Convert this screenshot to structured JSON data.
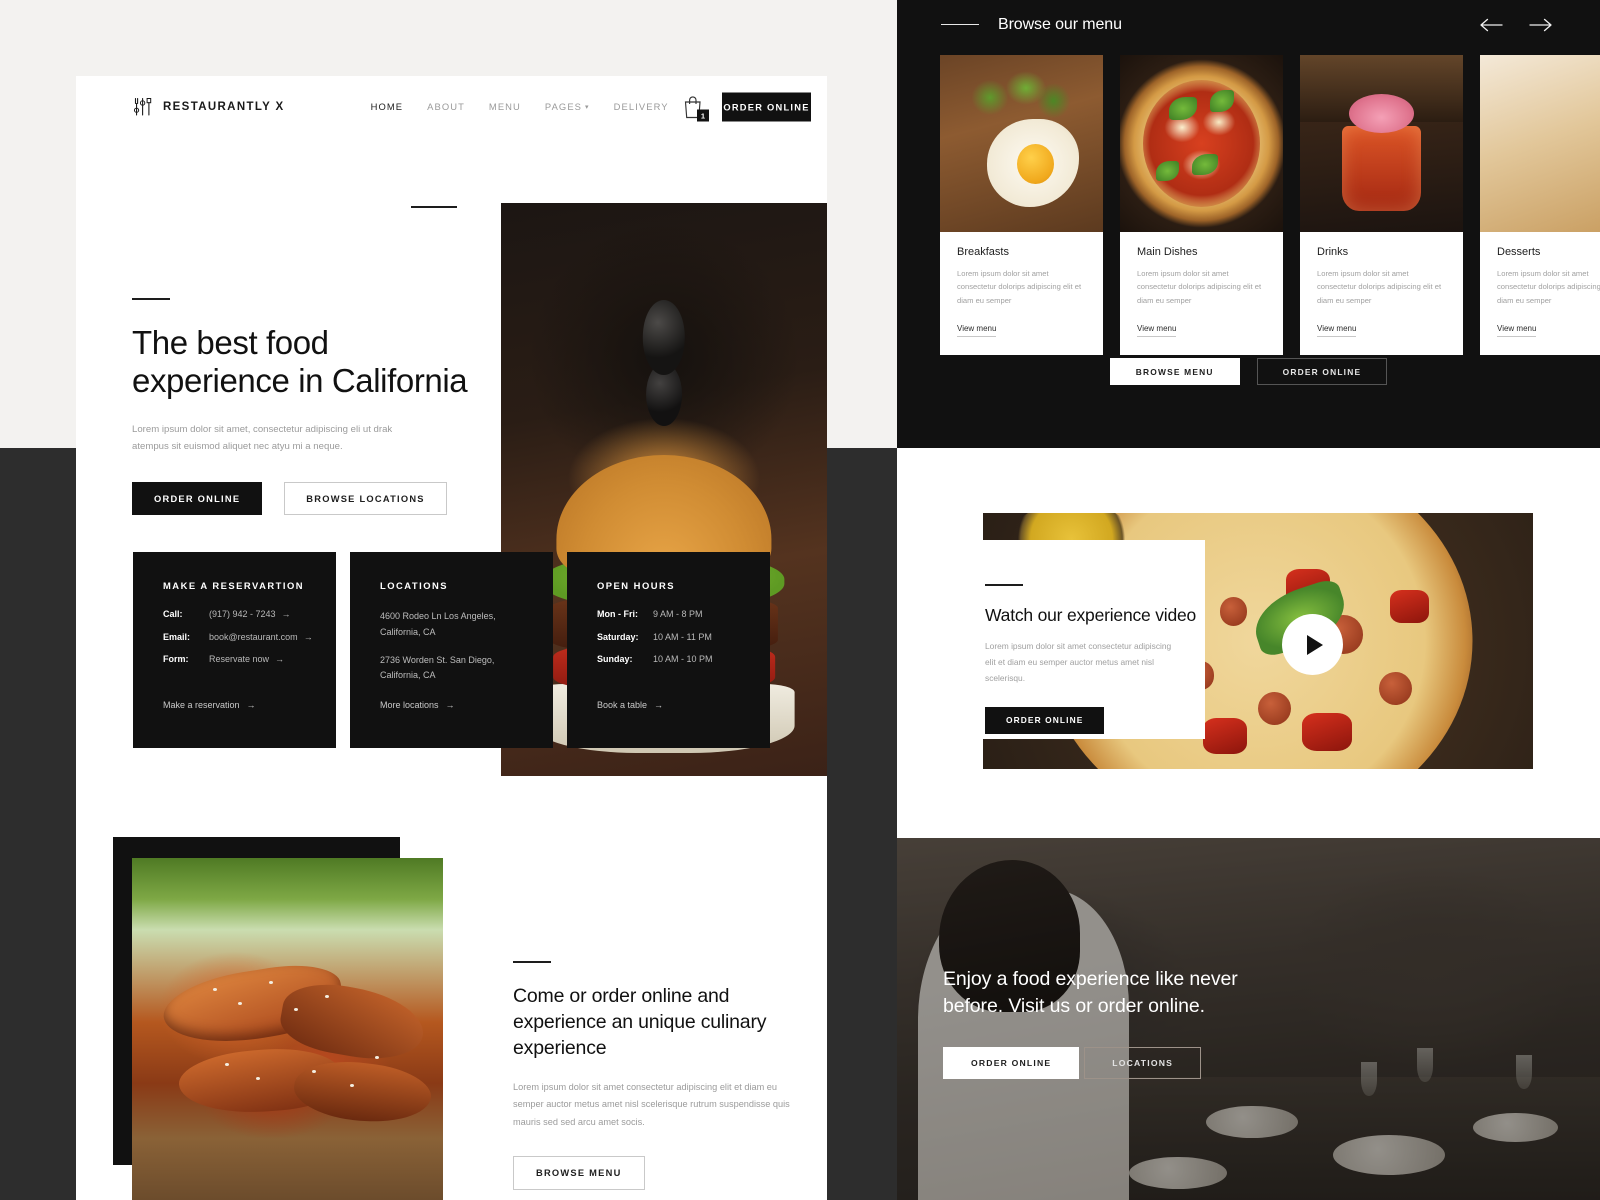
{
  "site": {
    "brand_name": "RESTAURANTLY X",
    "brand_icon": "cutlery-icon"
  },
  "header": {
    "nav": [
      {
        "label": "HOME",
        "active": true,
        "has_caret": false
      },
      {
        "label": "ABOUT",
        "active": false,
        "has_caret": false
      },
      {
        "label": "MENU",
        "active": false,
        "has_caret": false
      },
      {
        "label": "PAGES",
        "active": false,
        "has_caret": true
      },
      {
        "label": "DELIVERY",
        "active": false,
        "has_caret": false
      }
    ],
    "cart_icon": "shopping-bag-icon",
    "cart_count": "1",
    "order_button": "ORDER ONLINE"
  },
  "hero": {
    "title_line1": "The best food",
    "title_line2": "experience in California",
    "subtitle": "Lorem ipsum dolor sit amet, consectetur adipiscing eli ut drak atempus sit euismod aliquet nec atyu mi a neque.",
    "primary_button": "ORDER ONLINE",
    "secondary_button": "BROWSE LOCATIONS",
    "image_alt": "burger-photo"
  },
  "info_cards": [
    {
      "title": "MAKE A RESERVARTION",
      "rows": [
        {
          "key": "Call:",
          "value": "(917) 942 - 7243"
        },
        {
          "key": "Email:",
          "value": "book@restaurant.com"
        },
        {
          "key": "Form:",
          "value": "Reservate now"
        }
      ],
      "link": "Make a reservation"
    },
    {
      "title": "LOCATIONS",
      "addresses": [
        "4600 Rodeo Ln Los Angeles, California, CA",
        "2736 Worden St. San Diego, California, CA"
      ],
      "link": "More locations"
    },
    {
      "title": "OPEN HOURS",
      "rows": [
        {
          "key": "Mon - Fri:",
          "value": "9 AM -  8 PM"
        },
        {
          "key": "Saturday:",
          "value": "10 AM -  11 PM"
        },
        {
          "key": "Sunday:",
          "value": "10 AM -  10 PM"
        }
      ],
      "link": "Book a table"
    }
  ],
  "feature": {
    "title": "Come or order online and experience an unique culinary experience",
    "subtitle": "Lorem ipsum dolor sit amet consectetur adipiscing elit et diam eu semper auctor metus amet nisl scelerisque rutrum suspendisse quis mauris sed sed arcu amet socis.",
    "button": "BROWSE MENU",
    "image_alt": "chicken-wings-photo"
  },
  "menu_panel": {
    "title": "Browse our menu",
    "prev_icon": "arrow-left-icon",
    "next_icon": "arrow-right-icon",
    "cards": [
      {
        "title": "Breakfasts",
        "text": "Lorem ipsum dolor sit amet consectetur dolorips adipiscing elit et diam eu semper",
        "link": "View menu",
        "image_alt": "eggs-photo"
      },
      {
        "title": "Main Dishes",
        "text": "Lorem ipsum dolor sit amet consectetur dolorips adipiscing elit et diam eu semper",
        "link": "View menu",
        "image_alt": "pizza-photo"
      },
      {
        "title": "Drinks",
        "text": "Lorem ipsum dolor sit amet consectetur dolorips adipiscing elit et diam eu semper",
        "link": "View menu",
        "image_alt": "cocktail-photo"
      },
      {
        "title": "Desserts",
        "text": "Lorem ipsum dolor sit amet consectetur dolorips adipiscing elit et diam eu semper",
        "link": "View menu",
        "image_alt": "waffle-photo"
      }
    ],
    "browse_button": "BROWSE MENU",
    "order_button": "ORDER ONLINE"
  },
  "video_panel": {
    "title": "Watch our experience video",
    "subtitle": "Lorem ipsum dolor sit amet consectetur adipiscing elit et diam eu semper auctor metus amet nisl scelerisqu.",
    "button": "ORDER ONLINE",
    "play_icon": "play-icon",
    "image_alt": "pepperoni-pizza-photo"
  },
  "cta_panel": {
    "title_line1": "Enjoy a food experience like never",
    "title_line2": "before. Visit us or order online.",
    "primary_button": "ORDER ONLINE",
    "secondary_button": "LOCATIONS",
    "image_alt": "people-dining-photo"
  },
  "colors": {
    "ink": "#111111",
    "muted": "#9b9b9b",
    "page_bg": "#2d2d2d",
    "panel_light": "#f3f2f0"
  }
}
